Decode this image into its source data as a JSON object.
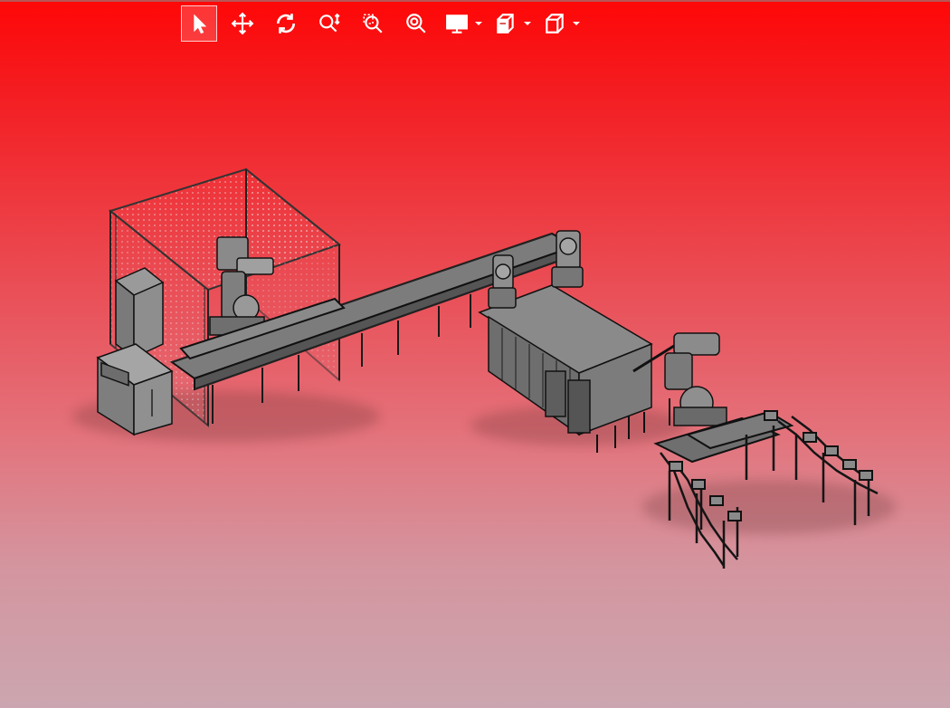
{
  "viewer": {
    "toolbar": {
      "tools": [
        {
          "id": "select",
          "icon": "select-arrow-icon",
          "active": true
        },
        {
          "id": "pan",
          "icon": "pan-move-icon"
        },
        {
          "id": "rotate",
          "icon": "rotate-icon"
        },
        {
          "id": "zoom",
          "icon": "zoom-vertical-icon"
        },
        {
          "id": "zoom-window",
          "icon": "zoom-window-icon"
        },
        {
          "id": "zoom-fit",
          "icon": "zoom-fit-icon"
        },
        {
          "id": "display",
          "icon": "display-monitor-icon",
          "has_menu": true
        },
        {
          "id": "section",
          "icon": "section-view-icon",
          "has_menu": true
        },
        {
          "id": "view-cube",
          "icon": "view-cube-icon",
          "has_menu": true
        }
      ]
    },
    "background": {
      "top_color": "#ff0707",
      "bottom_color": "#cba6b0"
    },
    "model": {
      "description_icon": "assembly-line-model",
      "line_color": "#111111",
      "fill_color": "#8c8c8c"
    }
  }
}
